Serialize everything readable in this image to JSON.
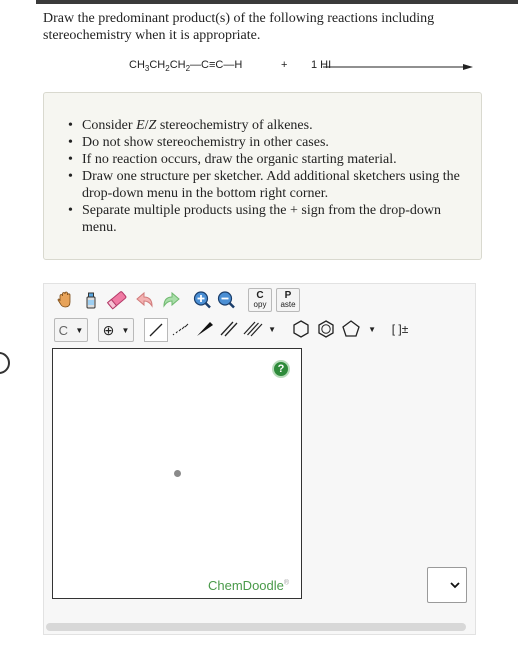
{
  "question": "Draw the predominant product(s) of the following reactions including stereochemistry when it is appropriate.",
  "reaction": {
    "reactant_label": "CH3CH2CH2—C≡C—H",
    "plus": "+",
    "reagent": "1 HI"
  },
  "instructions": [
    "Consider E/Z stereochemistry of alkenes.",
    "Do not show stereochemistry in other cases.",
    "If no reaction occurs, draw the organic starting material.",
    "Draw one structure per sketcher. Add additional sketchers using the drop-down menu in the bottom right corner.",
    "Separate multiple products using the + sign from the drop-down menu."
  ],
  "toolbar": {
    "row1": [
      "hand-icon",
      "eraser-bottle-icon",
      "eraser-icon",
      "undo-icon",
      "redo-icon",
      "zoom-in-icon",
      "zoom-out-icon"
    ],
    "copy_top": "C",
    "copy_bottom": "opy",
    "paste_top": "P",
    "paste_bottom": "aste",
    "atom_label": "C",
    "charge_label": "⊕",
    "brackets_label": "[ ]±"
  },
  "canvas": {
    "help_label": "?",
    "brand": "ChemDoodle",
    "brand_mark": "®"
  },
  "colors": {
    "brand_green": "#4a9a4a",
    "help_green": "#2e8b3a",
    "note_bg": "#f6f6f1"
  }
}
